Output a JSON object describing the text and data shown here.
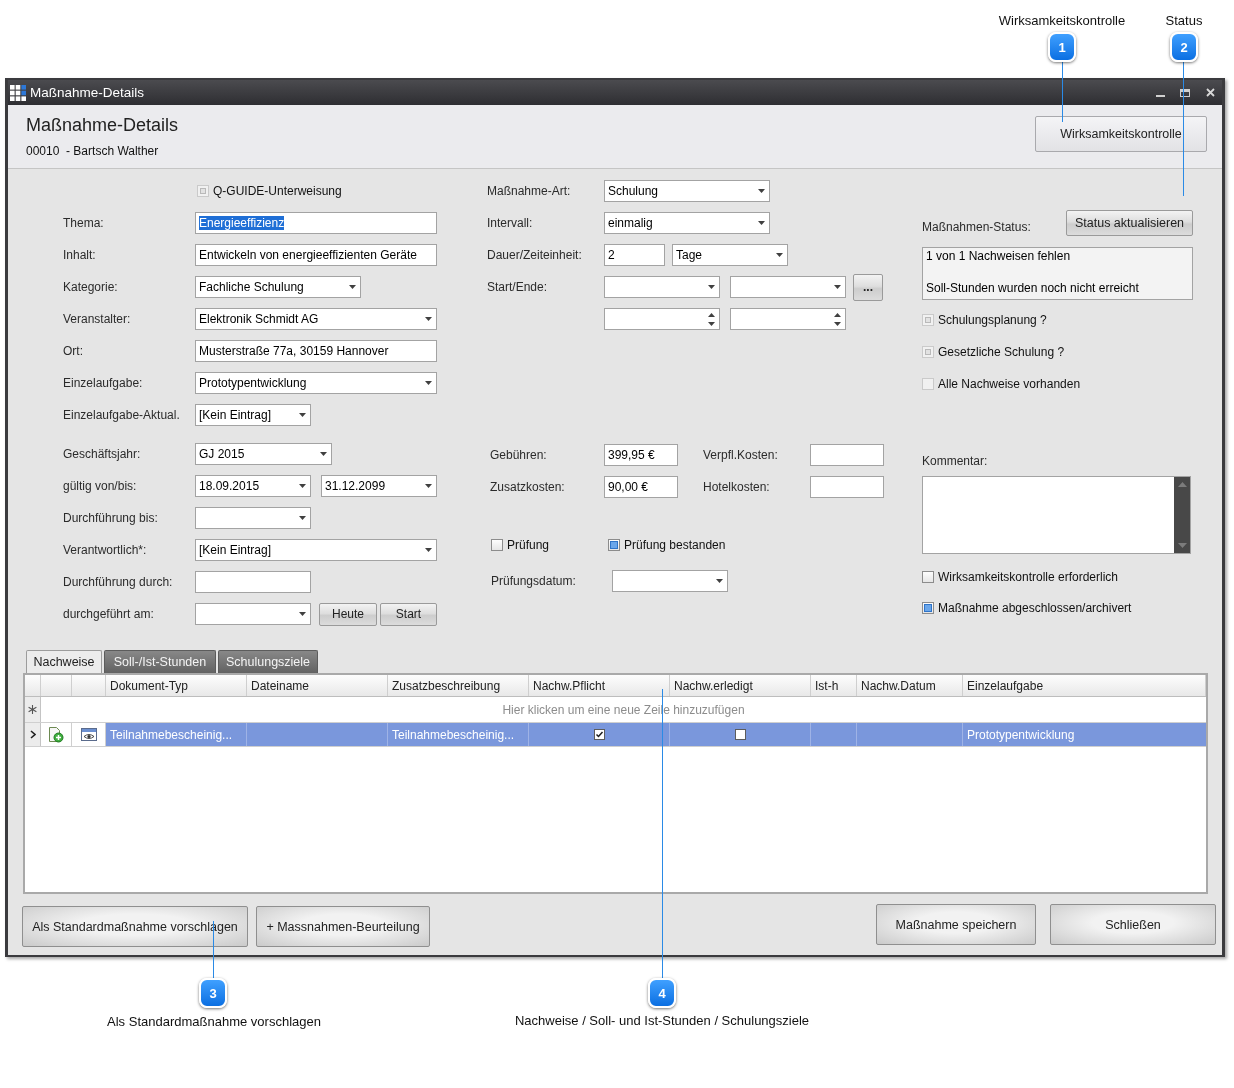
{
  "callouts": [
    {
      "number": "1",
      "label": "Wirksamkeitskontrolle"
    },
    {
      "number": "2",
      "label": "Status"
    },
    {
      "number": "3",
      "label": "Als Standardmaßnahme vorschlagen"
    },
    {
      "number": "4",
      "label": "Nachweise / Soll- und Ist-Stunden / Schulungsziele"
    }
  ],
  "window": {
    "title": "Maßnahme-Details"
  },
  "header": {
    "title": "Maßnahme-Details",
    "subtitle": "00010  - Bartsch Walther",
    "button": "Wirksamkeitskontrolle"
  },
  "general": {
    "option": {
      "label": "Q-GUIDE-Unterweisung",
      "checked": false,
      "indeterminate": true,
      "disabled": true
    },
    "fields": [
      {
        "label": "Thema:",
        "kind": "text",
        "value": "Energieeffizienz",
        "highlighted": true
      },
      {
        "label": "Inhalt:",
        "kind": "text",
        "value": "Entwickeln von energieeffizienten Geräte",
        "highlighted": false
      },
      {
        "label": "Kategorie:",
        "kind": "combo",
        "value": "Fachliche Schulung",
        "highlighted": false
      },
      {
        "label": "Veranstalter:",
        "kind": "combo",
        "value": "Elektronik Schmidt AG",
        "highlighted": false
      },
      {
        "label": "Ort:",
        "kind": "text",
        "value": "Musterstraße 77a, 30159 Hannover",
        "highlighted": false
      },
      {
        "label": "Einzelaufgabe:",
        "kind": "combo",
        "value": "Prototypentwicklung",
        "highlighted": false
      },
      {
        "label": "Einzelaufgabe-Aktual.",
        "kind": "combo",
        "value": "[Kein Eintrag]",
        "highlighted": false
      },
      {
        "label": "Geschäftsjahr:",
        "kind": "combo",
        "value": "GJ 2015",
        "highlighted": false
      },
      {
        "label": "gültig von/bis:",
        "kind": "range",
        "values": [
          "18.09.2015",
          "31.12.2099"
        ],
        "highlighted": false
      },
      {
        "label": "Durchführung bis:",
        "kind": "combo"
      },
      {
        "label": "Verantwortlich*:",
        "kind": "combo",
        "value": "[Kein Eintrag]",
        "highlighted": false
      },
      {
        "label": "Durchführung durch:",
        "kind": "text"
      },
      {
        "label": "durchgeführt am:",
        "kind": "combo",
        "buttons": [
          "Heute",
          "Start"
        ]
      }
    ]
  },
  "schedule": {
    "fields": [
      {
        "label": "Maßnahme-Art:",
        "kind": "combo",
        "value": "Schulung"
      },
      {
        "label": "Intervall:",
        "kind": "combo",
        "value": "einmalig"
      },
      {
        "label": "Dauer/Zeiteinheit:",
        "kind": "duration",
        "value": "2",
        "unit": "Tage"
      },
      {
        "label": "Start/Ende:",
        "kind": "range",
        "button": "..."
      },
      {
        "kind": "spin"
      }
    ]
  },
  "costs": {
    "fields": [
      {
        "label": "Gebühren:",
        "value": "399,95 €"
      },
      {
        "label": "Verpfl.Kosten:"
      },
      {
        "label": "Zusatzkosten:",
        "value": "90,00 €"
      },
      {
        "label": "Hotelkosten:"
      }
    ]
  },
  "exam": {
    "options": [
      {
        "label": "Prüfung",
        "checked": false
      },
      {
        "label": "Prüfung bestanden",
        "checked": true
      }
    ],
    "date_label": "Prüfungsdatum:"
  },
  "status": {
    "label": "Maßnahmen-Status:",
    "button": "Status aktualisieren",
    "messages": [
      "1 von 1 Nachweisen fehlen",
      "Soll-Stunden wurden noch nicht erreicht"
    ],
    "options": [
      {
        "label": "Schulungsplanung ?",
        "checked": false,
        "indeterminate": true,
        "disabled": true
      },
      {
        "label": "Gesetzliche Schulung ?",
        "checked": false,
        "indeterminate": true,
        "disabled": true
      },
      {
        "label": "Alle Nachweise vorhanden",
        "checked": false,
        "indeterminate": false,
        "disabled": true
      }
    ]
  },
  "comment": {
    "label": "Kommentar:"
  },
  "completion": {
    "options": [
      {
        "label": "Wirksamkeitskontrolle erforderlich",
        "checked": false
      },
      {
        "label": "Maßnahme abgeschlossen/archivert",
        "checked": true
      }
    ]
  },
  "tabs": [
    {
      "label": "Nachweise",
      "selected": true
    },
    {
      "label": "Soll-/Ist-Stunden",
      "selected": false
    },
    {
      "label": "Schulungsziele",
      "selected": false
    }
  ],
  "table": {
    "columns": [
      "Dokument-Typ",
      "Dateiname",
      "Zusatzbeschreibung",
      "Nachw.Pflicht",
      "Nachw.erledigt",
      "Ist-h",
      "Nachw.Datum",
      "Einzelaufgabe"
    ],
    "new_row_hint": "Hier klicken um eine neue Zeile hinzuzufügen",
    "rows": [
      {
        "selected": true,
        "document_type": "Teilnahmebescheinig...",
        "description": "Teilnahmebescheinig...",
        "required": true,
        "done": false,
        "task": "Prototypentwicklung"
      }
    ]
  },
  "footer": {
    "left_buttons": [
      "Als Standardmaßnahme vorschlagen",
      "+ Massnahmen-Beurteilung"
    ],
    "right_buttons": [
      "Maßnahme speichern",
      "Schließen"
    ]
  }
}
